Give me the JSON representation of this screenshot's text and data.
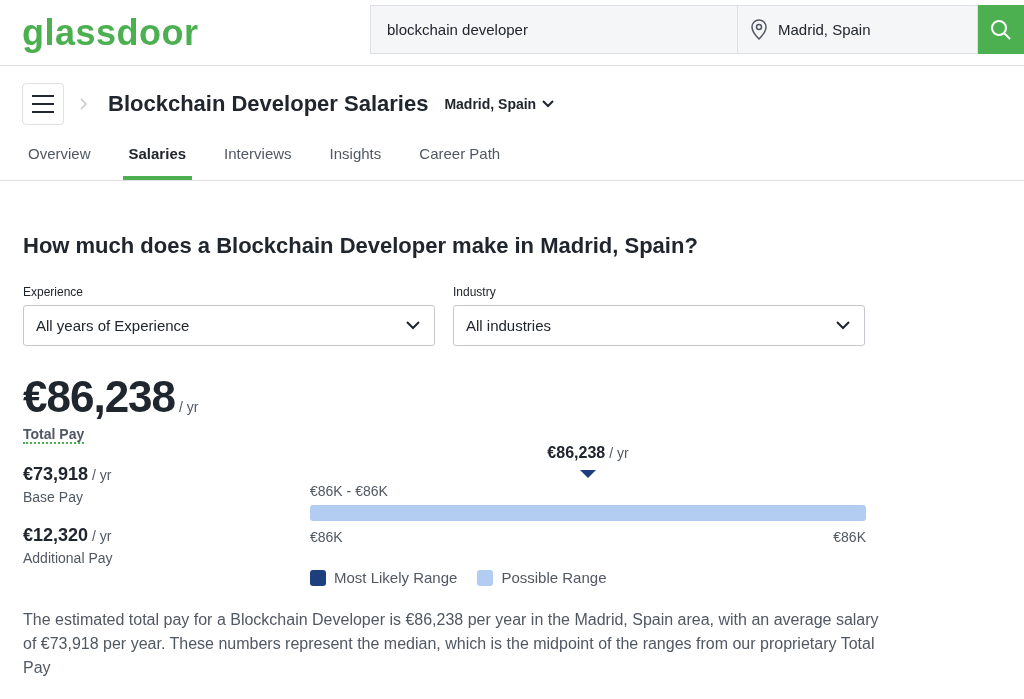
{
  "header": {
    "logo": "glassdoor",
    "search": {
      "value": "blockchain developer"
    },
    "location": {
      "value": "Madrid, Spain"
    }
  },
  "title_bar": {
    "title": "Blockchain Developer Salaries",
    "location": "Madrid, Spain"
  },
  "tabs": [
    {
      "label": "Overview",
      "selected": false
    },
    {
      "label": "Salaries",
      "selected": true
    },
    {
      "label": "Interviews",
      "selected": false
    },
    {
      "label": "Insights",
      "selected": false
    },
    {
      "label": "Career Path",
      "selected": false
    }
  ],
  "heading": "How much does a Blockchain Developer make in Madrid, Spain?",
  "filters": [
    {
      "label": "Experience",
      "value": "All years of Experience"
    },
    {
      "label": "Industry",
      "value": "All industries"
    }
  ],
  "total": {
    "amount": "€86,238",
    "unit": "/ yr",
    "label": "Total Pay"
  },
  "breakdown": [
    {
      "amount": "€73,918",
      "unit": "/ yr",
      "label": "Base Pay"
    },
    {
      "amount": "€12,320",
      "unit": "/ yr",
      "label": "Additional Pay"
    }
  ],
  "range": {
    "marker_amount": "€86,238",
    "marker_unit": "/ yr",
    "range_label": "€86K - €86K",
    "min": "€86K",
    "max": "€86K"
  },
  "legend": [
    {
      "label": "Most Likely Range",
      "color": "#1d3f7e"
    },
    {
      "label": "Possible Range",
      "color": "#b3cdf2"
    }
  ],
  "description": "The estimated total pay for a Blockchain Developer is €86,238 per year in the Madrid, Spain area, with an average salary of €73,918 per year. These numbers represent the median, which is the midpoint of the ranges from our proprietary Total Pay"
}
